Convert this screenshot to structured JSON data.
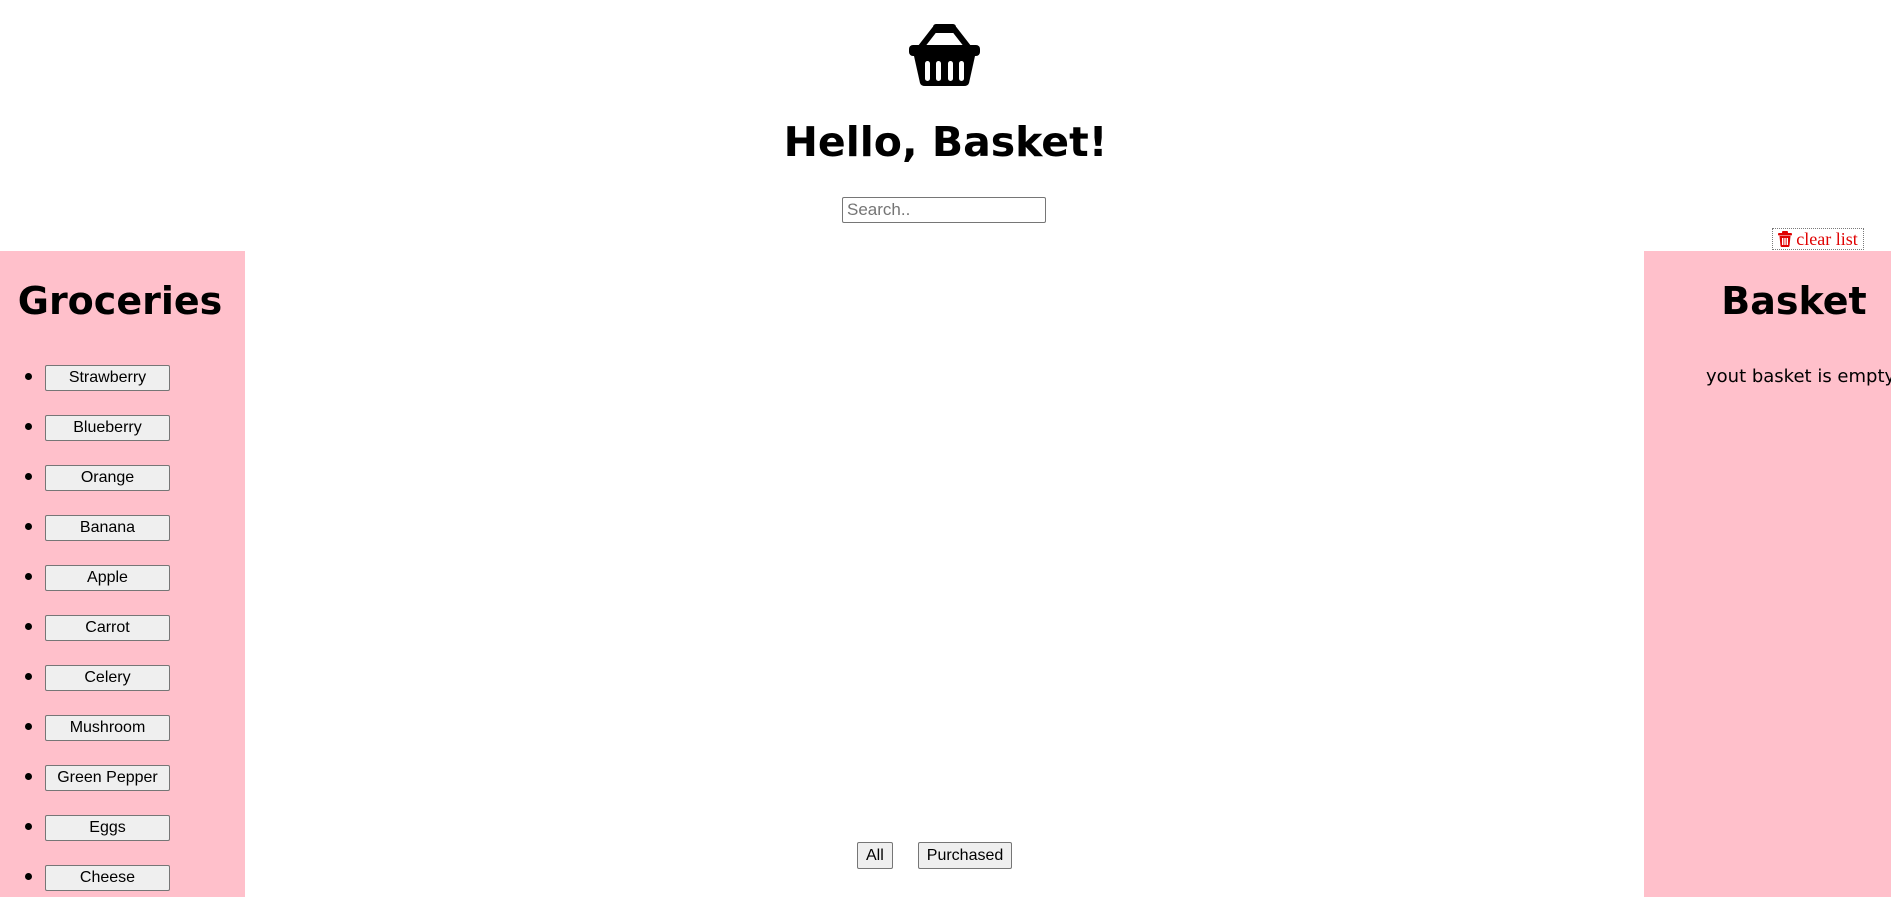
{
  "header": {
    "logo_icon": "shopping-basket-icon",
    "title": "Hello, Basket!",
    "search_placeholder": "Search..",
    "search_value": ""
  },
  "clear_button": {
    "icon": "trash-icon",
    "label": "clear list",
    "color": "#e00000"
  },
  "groceries": {
    "title": "Groceries",
    "items": [
      {
        "label": "Strawberry"
      },
      {
        "label": "Blueberry"
      },
      {
        "label": "Orange"
      },
      {
        "label": "Banana"
      },
      {
        "label": "Apple"
      },
      {
        "label": "Carrot"
      },
      {
        "label": "Celery"
      },
      {
        "label": "Mushroom"
      },
      {
        "label": "Green Pepper"
      },
      {
        "label": "Eggs"
      },
      {
        "label": "Cheese"
      }
    ]
  },
  "basket": {
    "title": "Basket",
    "empty_message": "yout basket is empty!"
  },
  "filters": {
    "all_label": "All",
    "purchased_label": "Purchased"
  },
  "colors": {
    "sidebar_bg": "#ffc0cb",
    "page_bg": "#ffffff"
  }
}
